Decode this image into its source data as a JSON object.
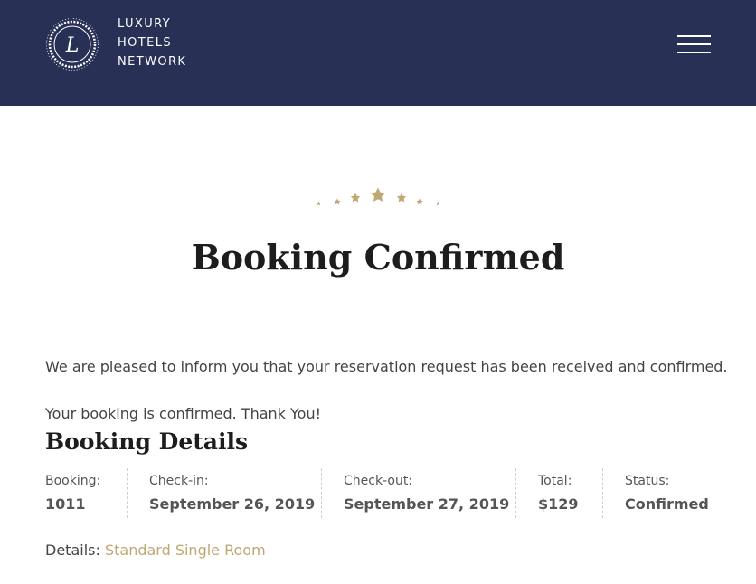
{
  "header": {
    "logo_lines": [
      "LUXURY",
      "HOTELS",
      "NETWORK"
    ],
    "logo_monogram": "L",
    "menu_icon": "hamburger-menu-icon",
    "background_color": "#283056"
  },
  "hero": {
    "stars_icon": "star-rating-icon",
    "accent_color": "#bfa874",
    "title": "Booking Confirmed"
  },
  "messages": {
    "intro": "We are pleased to inform you that your reservation request has been received and confirmed.",
    "thanks": "Your booking is confirmed. Thank You!"
  },
  "details": {
    "heading": "Booking Details",
    "booking": {
      "label": "Booking:",
      "value": "1011"
    },
    "checkin": {
      "label": "Check-in:",
      "value": "September 26, 2019"
    },
    "checkout": {
      "label": "Check-out:",
      "value": "September 27, 2019"
    },
    "total": {
      "label": "Total:",
      "value": "$129"
    },
    "status": {
      "label": "Status:",
      "value": "Confirmed"
    },
    "room_label": "Details:",
    "room_link": "Standard Single Room"
  }
}
